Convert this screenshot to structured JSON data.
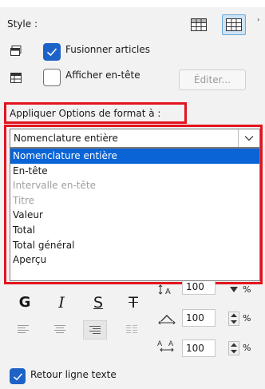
{
  "style_section": {
    "label": "Style :",
    "merge_items": {
      "label": "Fusionner articles",
      "checked": true
    },
    "show_header": {
      "label": "Afficher en-tête",
      "checked": false
    },
    "edit_button": "Éditer..."
  },
  "format_section": {
    "label": "Appliquer Options de format à :",
    "selected": "Nomenclature entière",
    "options": [
      {
        "label": "Nomenclature entière",
        "state": "selected"
      },
      {
        "label": "En-tête",
        "state": "normal"
      },
      {
        "label": "Intervalle en-tête",
        "state": "disabled"
      },
      {
        "label": "Titre",
        "state": "disabled"
      },
      {
        "label": "Valeur",
        "state": "normal"
      },
      {
        "label": "Total",
        "state": "normal"
      },
      {
        "label": "Total général",
        "state": "normal"
      },
      {
        "label": "Aperçu",
        "state": "normal"
      }
    ]
  },
  "text_format": {
    "bold": "G",
    "italic": "I",
    "underline": "S",
    "strike": "T",
    "height_value": "100",
    "width_value": "100",
    "spacing_value": "100",
    "percent": "%",
    "height_icon_label": "A",
    "spacing_icon_label": "A A"
  },
  "wrap_text": {
    "label": "Retour ligne texte",
    "checked": true
  },
  "colors": {
    "accent": "#1d63c7",
    "highlight": "#e3141f",
    "selection": "#0a64d6"
  }
}
